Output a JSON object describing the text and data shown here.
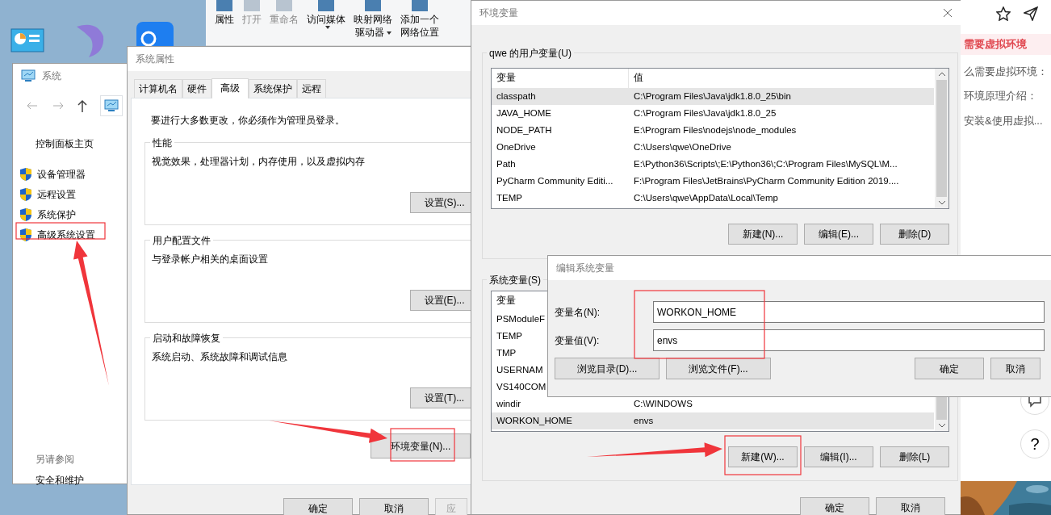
{
  "ribbon": {
    "items": [
      {
        "lines": [
          "属性"
        ],
        "disabled": false,
        "dropdown": false
      },
      {
        "lines": [
          "打开"
        ],
        "disabled": true,
        "dropdown": false
      },
      {
        "lines": [
          "重命名"
        ],
        "disabled": true,
        "dropdown": false
      },
      {
        "lines": [
          "访问媒体"
        ],
        "disabled": false,
        "dropdown": true
      },
      {
        "lines": [
          "映射网络",
          "驱动器"
        ],
        "disabled": false,
        "dropdown": true
      },
      {
        "lines": [
          "添加一个",
          "网络位置"
        ],
        "disabled": false,
        "dropdown": false
      }
    ]
  },
  "system_window": {
    "title": "系统",
    "home_link": "控制面板主页",
    "links": [
      {
        "label": "设备管理器"
      },
      {
        "label": "远程设置"
      },
      {
        "label": "系统保护"
      },
      {
        "label": "高级系统设置"
      }
    ],
    "see_also": "另请参阅",
    "see_also_links": [
      "安全和维护"
    ]
  },
  "system_properties": {
    "title": "系统属性",
    "tabs": [
      {
        "label": "计算机名",
        "selected": false
      },
      {
        "label": "硬件",
        "selected": false
      },
      {
        "label": "高级",
        "selected": true
      },
      {
        "label": "系统保护",
        "selected": false
      },
      {
        "label": "远程",
        "selected": false
      }
    ],
    "notice": "要进行大多数更改，你必须作为管理员登录。",
    "groups": [
      {
        "title": "性能",
        "description": "视觉效果，处理器计划，内存使用，以及虚拟内存",
        "button": "设置(S)..."
      },
      {
        "title": "用户配置文件",
        "description": "与登录帐户相关的桌面设置",
        "button": "设置(E)..."
      },
      {
        "title": "启动和故障恢复",
        "description": "系统启动、系统故障和调试信息",
        "button": "设置(T)..."
      }
    ],
    "env_button": "环境变量(N)...",
    "footer_buttons": [
      {
        "label": "确定",
        "disabled": false
      },
      {
        "label": "取消",
        "disabled": false
      },
      {
        "label": "应",
        "disabled": true
      }
    ]
  },
  "environment_variables": {
    "title": "环境变量",
    "user_section": {
      "title": "qwe 的用户变量(U)",
      "columns": [
        "变量",
        "值"
      ],
      "rows": [
        {
          "name": "classpath",
          "value": "C:\\Program Files\\Java\\jdk1.8.0_25\\bin",
          "selected": true
        },
        {
          "name": "JAVA_HOME",
          "value": "C:\\Program Files\\Java\\jdk1.8.0_25",
          "selected": false
        },
        {
          "name": "NODE_PATH",
          "value": "E:\\Program Files\\nodejs\\node_modules",
          "selected": false
        },
        {
          "name": "OneDrive",
          "value": "C:\\Users\\qwe\\OneDrive",
          "selected": false
        },
        {
          "name": "Path",
          "value": "E:\\Python36\\Scripts\\;E:\\Python36\\;C:\\Program Files\\MySQL\\M...",
          "selected": false
        },
        {
          "name": "PyCharm Community Editi...",
          "value": "F:\\Program Files\\JetBrains\\PyCharm Community Edition 2019....",
          "selected": false
        },
        {
          "name": "TEMP",
          "value": "C:\\Users\\qwe\\AppData\\Local\\Temp",
          "selected": false
        }
      ],
      "buttons": [
        "新建(N)...",
        "编辑(E)...",
        "删除(D)"
      ]
    },
    "system_section": {
      "title": "系统变量(S)",
      "columns": [
        "变量"
      ],
      "rows": [
        {
          "name": "PSModuleF",
          "selected": false
        },
        {
          "name": "TEMP",
          "selected": false
        },
        {
          "name": "TMP",
          "selected": false
        },
        {
          "name": "USERNAM",
          "selected": false
        },
        {
          "name": "VS140COM",
          "selected": false
        },
        {
          "name": "windir",
          "value": "C:\\WINDOWS",
          "selected": false
        },
        {
          "name": "WORKON_HOME",
          "value": "envs",
          "selected": true
        }
      ],
      "buttons": [
        "新建(W)...",
        "编辑(I)...",
        "删除(L)"
      ]
    },
    "footer_buttons": [
      "确定",
      "取消"
    ]
  },
  "edit_dialog": {
    "title": "编辑系统变量",
    "fields": [
      {
        "label": "变量名(N):",
        "value": "WORKON_HOME"
      },
      {
        "label": "变量值(V):",
        "value": "envs"
      }
    ],
    "buttons": [
      "浏览目录(D)...",
      "浏览文件(F)...",
      "确定",
      "取消"
    ]
  },
  "web_page": {
    "heading": "需要虚拟环境",
    "items": [
      "么需要虚拟环境：",
      "环境原理介绍：",
      "安装&使用虚拟..."
    ],
    "help_button": "?"
  }
}
